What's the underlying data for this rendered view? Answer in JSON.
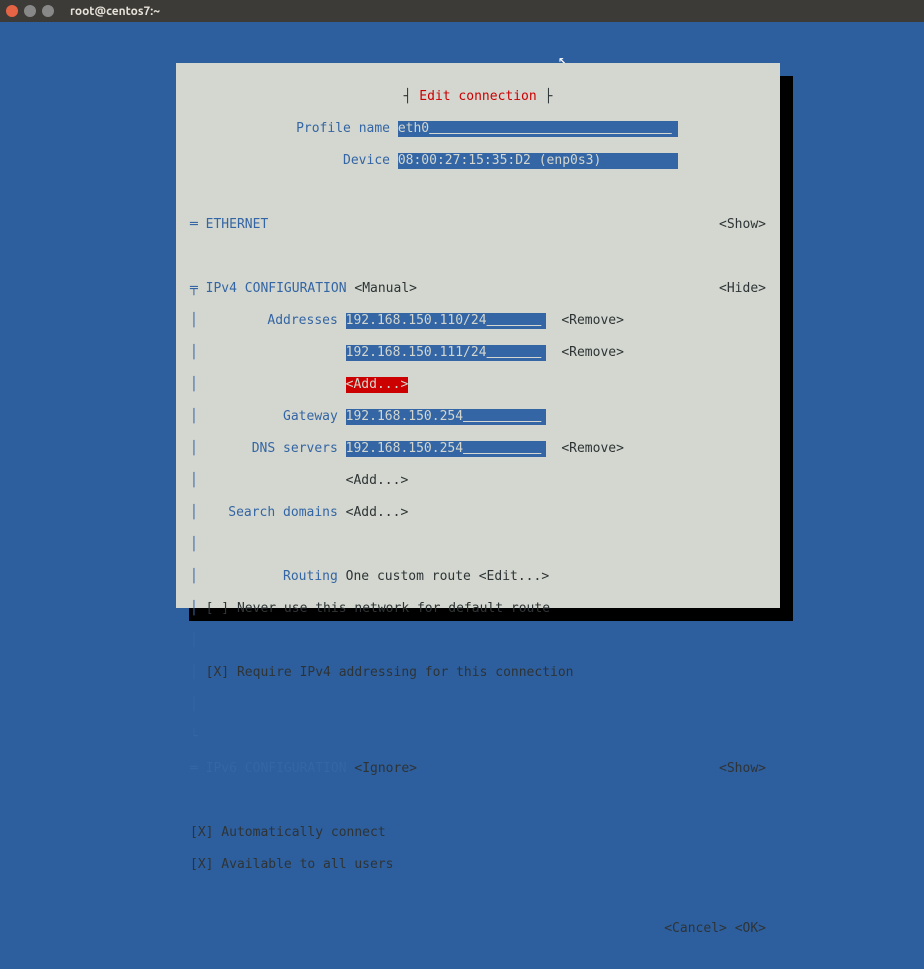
{
  "window": {
    "title": "root@centos7:~"
  },
  "dialog": {
    "title_rule_left": "┤ ",
    "title": "Edit connection",
    "title_rule_right": " ├",
    "profile_name_label": "Profile name",
    "profile_name_value": "eth0",
    "device_label": "Device",
    "device_value": "08:00:27:15:35:D2 (enp0s3)",
    "ethernet_section": "ETHERNET",
    "show": "<Show>",
    "hide": "<Hide>",
    "ipv4_section": "IPv4 CONFIGURATION",
    "ipv4_mode": "<Manual>",
    "addresses_label": "Addresses",
    "addresses": [
      "192.168.150.110/24",
      "192.168.150.111/24"
    ],
    "add_label": "<Add...>",
    "remove_label": "<Remove>",
    "gateway_label": "Gateway",
    "gateway_value": "192.168.150.254",
    "dns_label": "DNS servers",
    "dns_servers": [
      "192.168.150.254"
    ],
    "search_label": "Search domains",
    "routing_label": "Routing",
    "routing_value": "One custom route",
    "edit_label": "<Edit...>",
    "checkbox_default_route": "[ ] Never use this network for default route",
    "checkbox_require_ipv4": "[X] Require IPv4 addressing for this connection",
    "ipv6_section": "IPv6 CONFIGURATION",
    "ipv6_mode": "<Ignore>",
    "checkbox_auto_connect": "[X] Automatically connect",
    "checkbox_all_users": "[X] Available to all users",
    "cancel": "<Cancel>",
    "ok": "<OK>"
  }
}
